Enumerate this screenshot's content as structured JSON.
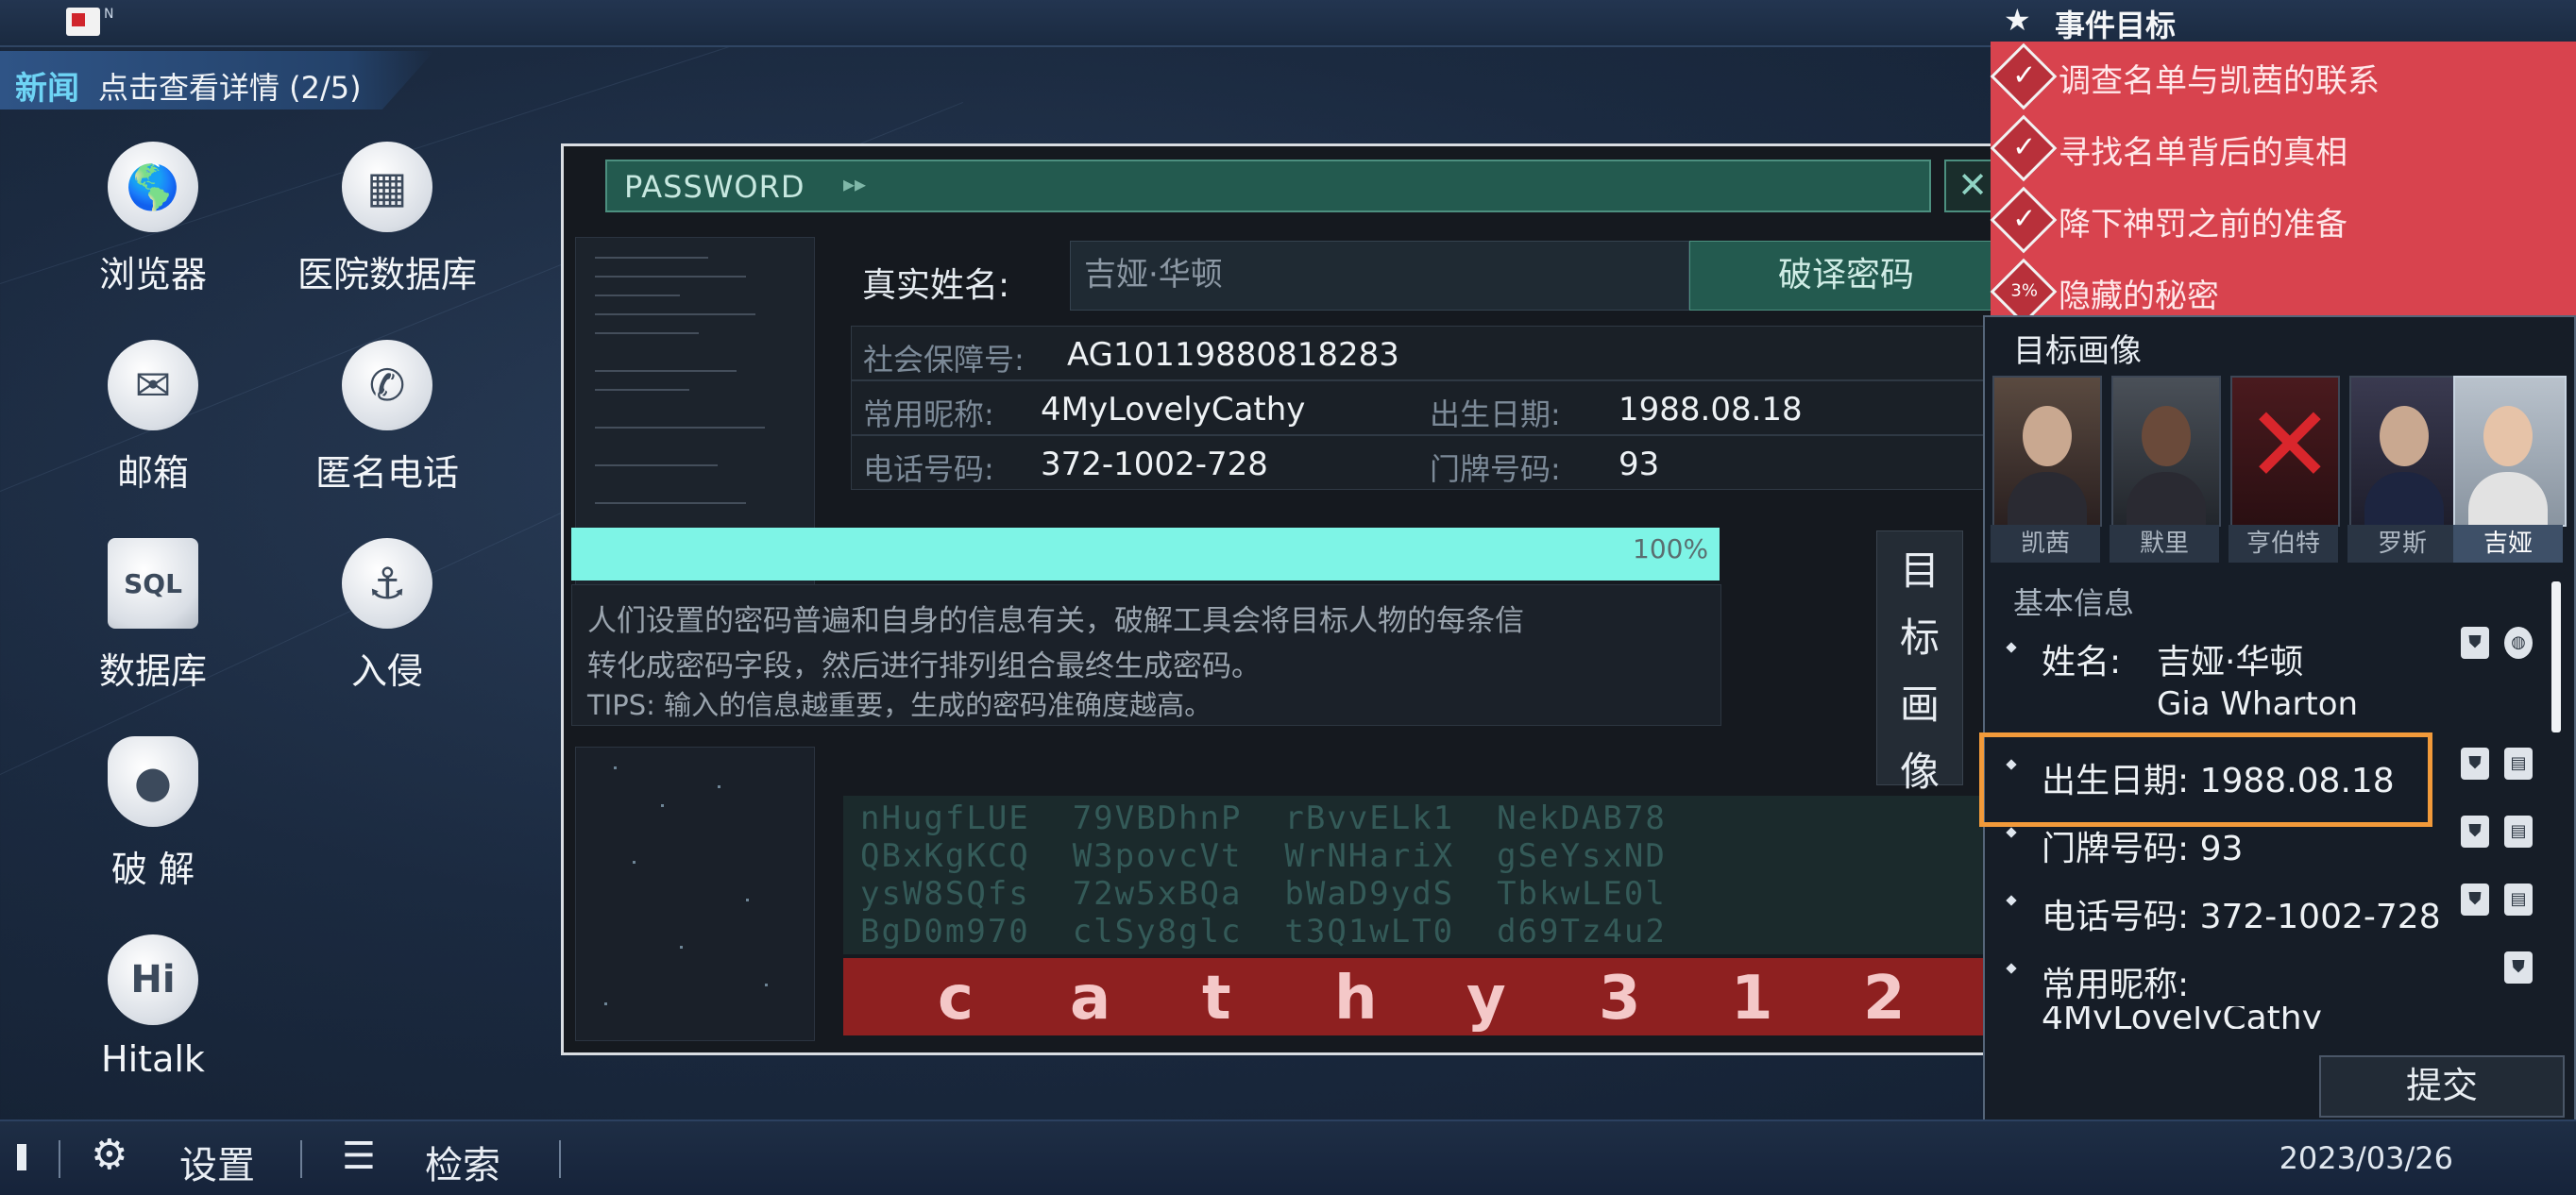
{
  "topbar": {
    "logo_text": "N"
  },
  "news": {
    "tag": "新闻",
    "text": "点击查看详情 (2/5)"
  },
  "desktop": {
    "icons": [
      {
        "label": "浏览器",
        "icon": "globe-icon",
        "glyph": "🌎"
      },
      {
        "label": "医院数据库",
        "icon": "hospital-icon",
        "glyph": "▦"
      },
      {
        "label": "邮箱",
        "icon": "mail-icon",
        "glyph": "✉"
      },
      {
        "label": "匿名电话",
        "icon": "phone-icon",
        "glyph": "✆"
      },
      {
        "label": "数据库",
        "icon": "sql-icon",
        "glyph": "SQL"
      },
      {
        "label": "入侵",
        "icon": "hook-icon",
        "glyph": "⚓"
      },
      {
        "label": "破 解",
        "icon": "lock-icon",
        "glyph": "●"
      },
      {
        "label": "Hitalk",
        "icon": "hitalk-icon",
        "glyph": "Hi"
      }
    ]
  },
  "bottombar": {
    "settings": "设置",
    "search": "检索",
    "date": "2023/03/26"
  },
  "password_window": {
    "title": "PASSWORD",
    "close": "✕",
    "real_name_label": "真实姓名:",
    "real_name_value": "吉娅·华顿",
    "crack_button": "破译密码",
    "ssn_label": "社会保障号:",
    "ssn_value": "AG10119880818283",
    "nickname_label": "常用昵称:",
    "nickname_value": "4MyLovelyCathy",
    "dob_label": "出生日期:",
    "dob_value": "1988.08.18",
    "phone_label": "电话号码:",
    "phone_value": "372-1002-728",
    "house_label": "门牌号码:",
    "house_value": "93",
    "progress_text": "100%",
    "progress": 1.0,
    "desc_line1": "人们设置的密码普遍和自身的信息有关，破解工具会将目标人物的每条信",
    "desc_line2": "转化成密码字段，然后进行排列组合最终生成密码。",
    "desc_line3": "TIPS: 输入的信息越重要，生成的密码准确度越高。",
    "side_tab": [
      "目",
      "标",
      "画",
      "像"
    ],
    "matrix_rows": [
      "nHugfLUE  79VBDhnP  rBvvELk1  NekDAB78",
      "QBxKgKCQ  W3povcVt  WrNHariX  gSeYsxND",
      "ysW8SQfs  72w5xBQa  bWaD9ydS  TbkwLE0l",
      "BgD0m970  clSy8glc  t3Q1wLT0  d69Tz4u2"
    ],
    "result": [
      "c",
      "a",
      "t",
      "h",
      "y",
      "3",
      "1",
      "2"
    ]
  },
  "objectives": {
    "title": "事件目标",
    "items": [
      {
        "text": "调查名单与凯茜的联系",
        "progress": ""
      },
      {
        "text": "寻找名单背后的真相",
        "progress": ""
      },
      {
        "text": "降下神罚之前的准备",
        "progress": ""
      },
      {
        "text": "隐藏的秘密",
        "progress": "3%"
      }
    ]
  },
  "target": {
    "title": "目标画像",
    "portraits": [
      "凯茜",
      "默里",
      "亨伯特",
      "罗斯",
      "吉娅"
    ],
    "selected": "吉娅",
    "info_title": "基本信息",
    "name_label": "姓名:",
    "name_cn": "吉娅·华顿",
    "name_en": "Gia Wharton",
    "dob": "出生日期: 1988.08.18",
    "house": "门牌号码: 93",
    "phone": "电话号码: 372-1002-728",
    "nickname_label": "常用昵称:",
    "nickname_partial": "4MyLovelyCathy",
    "submit": "提交"
  },
  "colors": {
    "accent_teal": "#7ef4e6",
    "objective_red": "#d8434e",
    "highlight_orange": "#f29a3a",
    "result_red": "#8e2020"
  }
}
